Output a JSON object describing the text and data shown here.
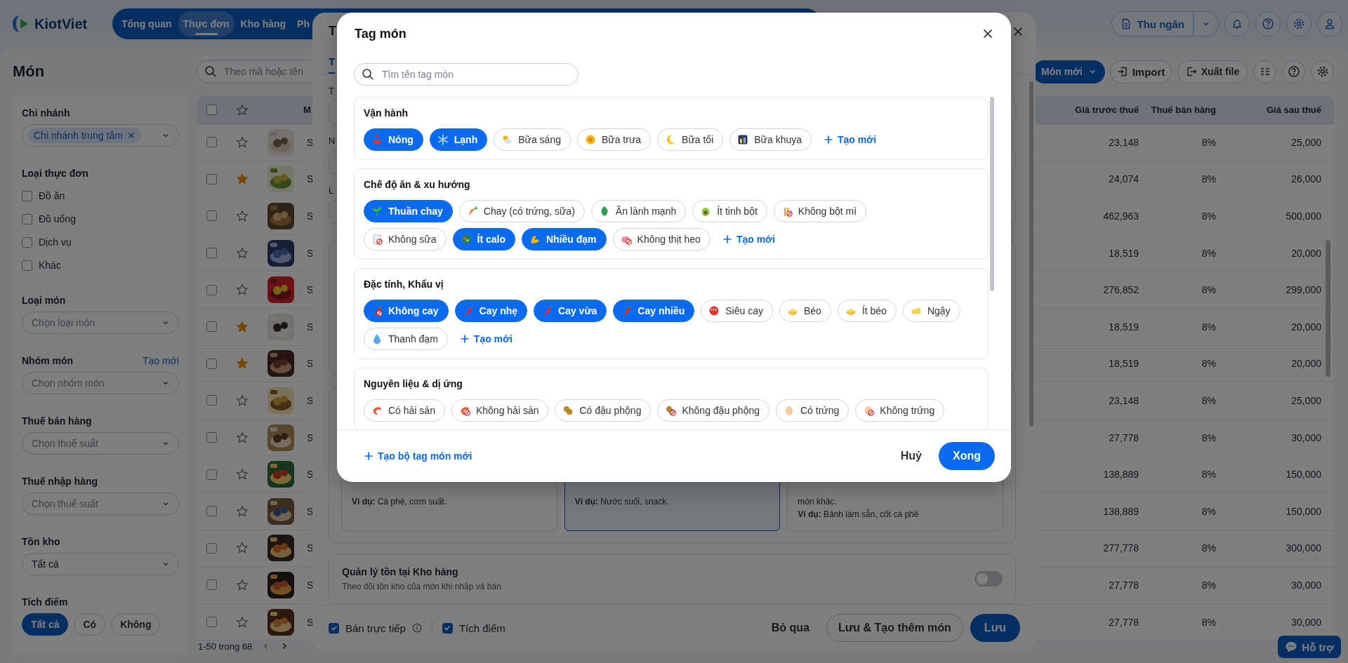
{
  "header": {
    "logo": "KiotViet",
    "nav": [
      {
        "label": "Tổng quan",
        "selected": false
      },
      {
        "label": "Thực đơn",
        "selected": true
      },
      {
        "label": "Kho hàng",
        "selected": false
      },
      {
        "label": "Ph",
        "selected": false
      }
    ],
    "cashier": "Thu ngân"
  },
  "page": {
    "title": "Món",
    "search_placeholder": "Theo mã hoặc tên",
    "new_button": "Món mới",
    "import_button": "Import",
    "export_button": "Xuất file"
  },
  "filters": {
    "branch": {
      "label": "Chi nhánh",
      "tag": "Chi nhánh trung tâm"
    },
    "menu_type": {
      "label": "Loại thực đơn",
      "options": [
        {
          "label": "Đồ ăn",
          "checked": false
        },
        {
          "label": "Đồ uống",
          "checked": false
        },
        {
          "label": "Dịch vụ",
          "checked": false
        },
        {
          "label": "Khác",
          "checked": false
        }
      ]
    },
    "selects": [
      {
        "label": "Loại món",
        "placeholder": "Chọn loại món"
      },
      {
        "label": "Nhóm món",
        "placeholder": "Chọn nhóm món",
        "link": "Tạo mới"
      },
      {
        "label": "Thuế bán hàng",
        "placeholder": "Chọn thuế suất"
      },
      {
        "label": "Thuế nhập hàng",
        "placeholder": "Chọn thuế suất"
      },
      {
        "label": "Tồn kho",
        "value": "Tất cả"
      }
    ],
    "points": {
      "label": "Tích điểm",
      "options": [
        {
          "label": "Tất cả",
          "selected": true
        },
        {
          "label": "Có",
          "selected": false
        },
        {
          "label": "Không",
          "selected": false
        }
      ]
    }
  },
  "table": {
    "select_all_checked": false,
    "columns": [
      "M",
      "Giá trước thuế",
      "Thuế bán hàng",
      "Giá sau thuế"
    ],
    "rows": [
      {
        "checked": false,
        "starred": false,
        "name": "S",
        "price_before_tax": "23,148",
        "tax": "8%",
        "price_after_tax": "25,000"
      },
      {
        "checked": false,
        "starred": true,
        "name": "S",
        "price_before_tax": "24,074",
        "tax": "8%",
        "price_after_tax": "26,000"
      },
      {
        "checked": false,
        "starred": false,
        "name": "S",
        "price_before_tax": "462,963",
        "tax": "8%",
        "price_after_tax": "500,000"
      },
      {
        "checked": false,
        "starred": false,
        "name": "S",
        "price_before_tax": "18,519",
        "tax": "8%",
        "price_after_tax": "20,000"
      },
      {
        "checked": false,
        "starred": false,
        "name": "S",
        "price_before_tax": "276,852",
        "tax": "8%",
        "price_after_tax": "299,000"
      },
      {
        "checked": false,
        "starred": true,
        "name": "S",
        "price_before_tax": "18,519",
        "tax": "8%",
        "price_after_tax": "20,000"
      },
      {
        "checked": false,
        "starred": true,
        "name": "S",
        "price_before_tax": "18,519",
        "tax": "8%",
        "price_after_tax": "20,000"
      },
      {
        "checked": false,
        "starred": false,
        "name": "S",
        "price_before_tax": "23,148",
        "tax": "8%",
        "price_after_tax": "25,000"
      },
      {
        "checked": false,
        "starred": false,
        "name": "S",
        "price_before_tax": "27,778",
        "tax": "8%",
        "price_after_tax": "30,000"
      },
      {
        "checked": false,
        "starred": false,
        "name": "S",
        "price_before_tax": "138,889",
        "tax": "8%",
        "price_after_tax": "150,000"
      },
      {
        "checked": false,
        "starred": false,
        "name": "S",
        "price_before_tax": "138,889",
        "tax": "8%",
        "price_after_tax": "150,000"
      },
      {
        "checked": false,
        "starred": false,
        "name": "S",
        "price_before_tax": "277,778",
        "tax": "8%",
        "price_after_tax": "300,000"
      },
      {
        "checked": false,
        "starred": false,
        "name": "S",
        "price_before_tax": "27,778",
        "tax": "8%",
        "price_after_tax": "30,000"
      },
      {
        "checked": false,
        "starred": false,
        "name": "S",
        "price_before_tax": "27,778",
        "tax": "8%",
        "price_after_tax": "30,000"
      }
    ]
  },
  "pagination": "1-50 trong 68",
  "support_button": "Hỗ trợ",
  "item_dialog": {
    "title": "T",
    "tab": {
      "label": "T",
      "selected": true
    },
    "labels": [
      "T",
      "N",
      "L"
    ],
    "type_cards": [
      {
        "selected": false,
        "lines": [
          "**Ví dụ:** Cà phê, cơm suất."
        ]
      },
      {
        "selected": true,
        "lines": [
          "**Ví dụ:** Nước suối, snack."
        ]
      },
      {
        "selected": false,
        "lines": [
          "món khác.",
          "**Ví dụ:** Bánh làm sẵn, cốt cà phê"
        ]
      }
    ],
    "inventory": {
      "title": "Quản lý tồn tại Kho hàng",
      "description": "Theo dõi tồn kho của món khi nhập và bán",
      "on": false
    },
    "options": [
      {
        "label": "Bán trực tiếp",
        "checked": true,
        "info": true
      },
      {
        "label": "Tích điểm",
        "checked": true,
        "info": false
      }
    ],
    "skip": "Bỏ qua",
    "save_and_new": "Lưu & Tạo thêm món",
    "save": "Lưu"
  },
  "tag_dialog": {
    "title": "Tag món",
    "search_placeholder": "Tìm tên tag món",
    "groups": [
      {
        "title": "Vận hành",
        "create": "Tạo mới",
        "tags": [
          {
            "label": "Nóng",
            "selected": true
          },
          {
            "label": "Lạnh",
            "selected": true
          },
          {
            "label": "Bữa sáng",
            "selected": false
          },
          {
            "label": "Bữa trưa",
            "selected": false
          },
          {
            "label": "Bữa tối",
            "selected": false
          },
          {
            "label": "Bữa khuya",
            "selected": false
          }
        ]
      },
      {
        "title": "Chế độ ăn & xu hướng",
        "create": "Tạo mới",
        "tags": [
          {
            "label": "Thuần chay",
            "selected": true
          },
          {
            "label": "Chay (có trứng, sữa)",
            "selected": false
          },
          {
            "label": "Ăn lành mạnh",
            "selected": false
          },
          {
            "label": "Ít tinh bột",
            "selected": false
          },
          {
            "label": "Không bột mì",
            "selected": false
          },
          {
            "label": "Không sữa",
            "selected": false
          },
          {
            "label": "Ít calo",
            "selected": true
          },
          {
            "label": "Nhiều đạm",
            "selected": true
          },
          {
            "label": "Không thịt heo",
            "selected": false
          }
        ]
      },
      {
        "title": "Đặc tính, Khẩu vị",
        "create": "Tạo mới",
        "tags": [
          {
            "label": "Không cay",
            "selected": true
          },
          {
            "label": "Cay nhẹ",
            "selected": true
          },
          {
            "label": "Cay vừa",
            "selected": true
          },
          {
            "label": "Cay nhiều",
            "selected": true
          },
          {
            "label": "Siêu cay",
            "selected": false
          },
          {
            "label": "Béo",
            "selected": false
          },
          {
            "label": "Ít béo",
            "selected": false
          },
          {
            "label": "Ngậy",
            "selected": false
          },
          {
            "label": "Thanh đạm",
            "selected": false
          }
        ]
      },
      {
        "title": "Nguyên liệu & dị ứng",
        "tags": [
          {
            "label": "Có hải sản",
            "selected": false
          },
          {
            "label": "Không hải sản",
            "selected": false
          },
          {
            "label": "Có đậu phộng",
            "selected": false
          },
          {
            "label": "Không đậu phộng",
            "selected": false
          },
          {
            "label": "Có trứng",
            "selected": false
          },
          {
            "label": "Không trứng",
            "selected": false
          }
        ]
      }
    ],
    "create_set": "Tạo bộ tag món mới",
    "cancel": "Huỷ",
    "done": "Xong"
  }
}
